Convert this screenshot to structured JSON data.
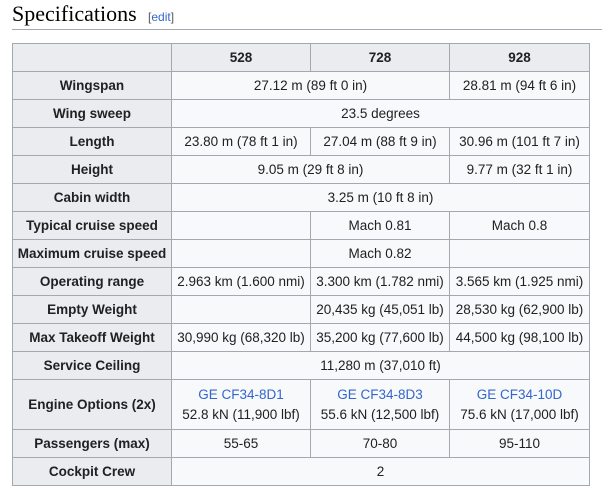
{
  "section": {
    "title": "Specifications",
    "edit_open": "[",
    "edit_label": "edit",
    "edit_close": "]"
  },
  "columns": [
    "",
    "528",
    "728",
    "928"
  ],
  "rows": {
    "wingspan": {
      "label": "Wingspan",
      "v528_728": "27.12 m (89 ft 0 in)",
      "v928": "28.81 m (94 ft 6 in)"
    },
    "wing_sweep": {
      "label": "Wing sweep",
      "all": "23.5 degrees"
    },
    "length": {
      "label": "Length",
      "v528": "23.80 m (78 ft 1 in)",
      "v728": "27.04 m (88 ft 9 in)",
      "v928": "30.96 m (101 ft 7 in)"
    },
    "height": {
      "label": "Height",
      "v528_728": "9.05 m (29 ft 8 in)",
      "v928": "9.77 m (32 ft 1 in)"
    },
    "cabin_width": {
      "label": "Cabin width",
      "all": "3.25 m (10 ft 8 in)"
    },
    "typical_cruise": {
      "label": "Typical cruise speed",
      "v528": "",
      "v728": "Mach 0.81",
      "v928": "Mach 0.8"
    },
    "max_cruise": {
      "label": "Maximum cruise speed",
      "v528": "",
      "v728": "Mach 0.82",
      "v928": ""
    },
    "range": {
      "label": "Operating range",
      "v528": "2.963 km (1.600 nmi)",
      "v728": "3.300 km (1.782 nmi)",
      "v928": "3.565 km (1.925 nmi)"
    },
    "empty_weight": {
      "label": "Empty Weight",
      "v528": "",
      "v728": "20,435 kg (45,051 lb)",
      "v928": "28,530 kg (62,900 lb)"
    },
    "mtow": {
      "label": "Max Takeoff Weight",
      "v528": "30,990 kg (68,320 lb)",
      "v728": "35,200 kg (77,600 lb)",
      "v928": "44,500 kg (98,100 lb)"
    },
    "ceiling": {
      "label": "Service Ceiling",
      "all": "11,280 m (37,010 ft)"
    },
    "engines": {
      "label": "Engine Options (2x)",
      "e528_name": "GE CF34-8D1",
      "e528_thrust": "52.8 kN (11,900 lbf)",
      "e728_name": "GE CF34-8D3",
      "e728_thrust": "55.6 kN (12,500 lbf)",
      "e928_name": "GE CF34-10D",
      "e928_thrust": "75.6 kN (17,000 lbf)"
    },
    "passengers": {
      "label": "Passengers (max)",
      "v528": "55-65",
      "v728": "70-80",
      "v928": "95-110"
    },
    "crew": {
      "label": "Cockpit Crew",
      "all": "2"
    }
  },
  "colors": {
    "header_bg": "#eaecf0",
    "cell_bg": "#f8f9fa",
    "border": "#a2a9b1",
    "link": "#3366cc"
  }
}
